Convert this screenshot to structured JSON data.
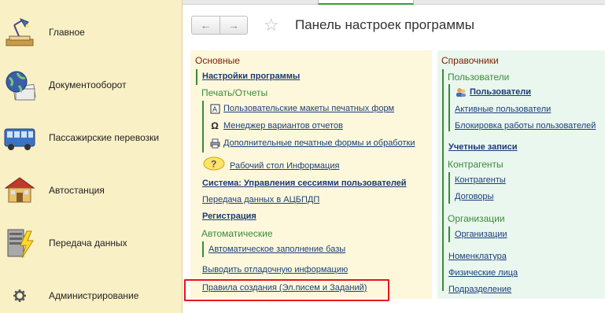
{
  "sidebar": {
    "items": [
      {
        "label": "Главное",
        "icon": "desk-lamp-icon"
      },
      {
        "label": "Документооборот",
        "icon": "globe-documents-icon"
      },
      {
        "label": "Пассажирские перевозки",
        "icon": "bus-icon"
      },
      {
        "label": "Автостанция",
        "icon": "bus-station-icon"
      },
      {
        "label": "Передача данных",
        "icon": "server-lightning-icon"
      },
      {
        "label": "Администрирование",
        "icon": "gear-icon"
      }
    ]
  },
  "header": {
    "back": "←",
    "forward": "→",
    "star": "☆",
    "title": "Панель настроек программы"
  },
  "main": {
    "section_title": "Основные",
    "settings_link": "Настройки программы",
    "print_group": "Печать/Отчеты",
    "print_links": [
      "Пользовательские макеты печатных форм",
      "Менеджер вариантов отчетов",
      "Дополнительные печатные формы и обработки"
    ],
    "desktop_link": "Рабочий стол Информация",
    "session_link": "Система: Управления сессиями пользователей",
    "transfer_link": "Передача данных в АЦБПДП",
    "registration_link": "Регистрация",
    "auto_group": "Автоматические",
    "auto_fill_link": "Автоматическое заполнение базы",
    "debug_link": "Выводить отладочную информацию",
    "rules_link": "Правила создания (Эл.писем и Заданий)"
  },
  "refs": {
    "section_title": "Справочники",
    "users_group": "Пользователи",
    "users_links": [
      "Пользователи",
      "Активные пользователи",
      "Блокировка работы пользователей"
    ],
    "accounts_link": "Учетные записи",
    "contractors_group": "Контрагенты",
    "contractors_links": [
      "Контрагенты",
      "Договоры"
    ],
    "orgs_group": "Организации",
    "orgs_links": [
      "Организации"
    ],
    "other_links": [
      "Номенклатура",
      "Физические лица",
      "Подразделение"
    ]
  },
  "colors": {
    "sidebar_bg": "#f9f0c6",
    "main_panel_bg": "#fdf8dc",
    "ref_panel_bg": "#eaf7ee",
    "highlight": "#e8141c",
    "group_green": "#3b8a3b",
    "section_red": "#7a1e00"
  }
}
